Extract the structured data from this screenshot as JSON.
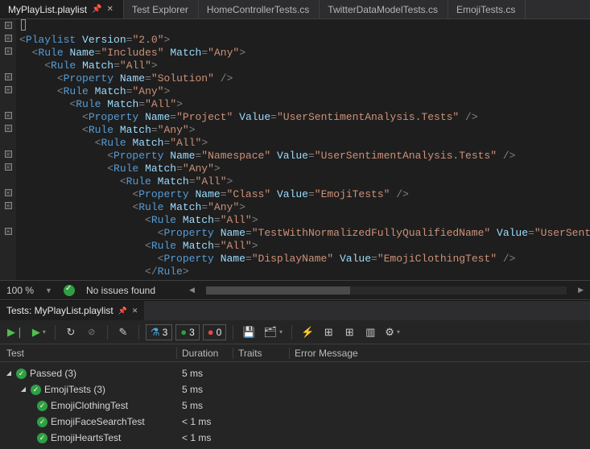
{
  "tabs": {
    "active": "MyPlayList.playlist",
    "items": [
      "MyPlayList.playlist",
      "Test Explorer",
      "HomeControllerTests.cs",
      "TwitterDataModelTests.cs",
      "EmojiTests.cs"
    ]
  },
  "xml": {
    "l01": {
      "elem": "Playlist",
      "attr1": "Version",
      "val1": "2.0"
    },
    "l02": {
      "elem": "Rule",
      "attr1": "Name",
      "val1": "Includes",
      "attr2": "Match",
      "val2": "Any"
    },
    "l03": {
      "elem": "Rule",
      "attr1": "Match",
      "val1": "All"
    },
    "l04": {
      "elem": "Property",
      "attr1": "Name",
      "val1": "Solution"
    },
    "l05": {
      "elem": "Rule",
      "attr1": "Match",
      "val1": "Any"
    },
    "l06": {
      "elem": "Rule",
      "attr1": "Match",
      "val1": "All"
    },
    "l07": {
      "elem": "Property",
      "attr1": "Name",
      "val1": "Project",
      "attr2": "Value",
      "val2": "UserSentimentAnalysis.Tests"
    },
    "l08": {
      "elem": "Rule",
      "attr1": "Match",
      "val1": "Any"
    },
    "l09": {
      "elem": "Rule",
      "attr1": "Match",
      "val1": "All"
    },
    "l10": {
      "elem": "Property",
      "attr1": "Name",
      "val1": "Namespace",
      "attr2": "Value",
      "val2": "UserSentimentAnalysis.Tests"
    },
    "l11": {
      "elem": "Rule",
      "attr1": "Match",
      "val1": "Any"
    },
    "l12": {
      "elem": "Rule",
      "attr1": "Match",
      "val1": "All"
    },
    "l13": {
      "elem": "Property",
      "attr1": "Name",
      "val1": "Class",
      "attr2": "Value",
      "val2": "EmojiTests"
    },
    "l14": {
      "elem": "Rule",
      "attr1": "Match",
      "val1": "Any"
    },
    "l15": {
      "elem": "Rule",
      "attr1": "Match",
      "val1": "All"
    },
    "l16": {
      "elem": "Property",
      "attr1": "Name",
      "val1": "TestWithNormalizedFullyQualifiedName",
      "attr2": "Value",
      "val2": "UserSentimentA"
    },
    "l17": {
      "elem": "Rule",
      "attr1": "Match",
      "val1": "All"
    },
    "l18": {
      "elem": "Property",
      "attr1": "Name",
      "val1": "DisplayName",
      "attr2": "Value",
      "val2": "EmojiClothingTest"
    },
    "l19": {
      "elem": "Rule"
    }
  },
  "status": {
    "zoom": "100 %",
    "issues": "No issues found"
  },
  "testPanel": {
    "title": "Tests: MyPlayList.playlist",
    "counts": {
      "total": "3",
      "passed": "3",
      "failed": "0"
    },
    "headers": {
      "test": "Test",
      "duration": "Duration",
      "traits": "Traits",
      "error": "Error Message"
    },
    "rows": [
      {
        "indent": 0,
        "name": "Passed (3)",
        "duration": "5 ms",
        "expandable": true
      },
      {
        "indent": 1,
        "name": "EmojiTests (3)",
        "duration": "5 ms",
        "expandable": true
      },
      {
        "indent": 2,
        "name": "EmojiClothingTest",
        "duration": "5 ms",
        "expandable": false
      },
      {
        "indent": 2,
        "name": "EmojiFaceSearchTest",
        "duration": "< 1 ms",
        "expandable": false
      },
      {
        "indent": 2,
        "name": "EmojiHeartsTest",
        "duration": "< 1 ms",
        "expandable": false
      }
    ]
  }
}
